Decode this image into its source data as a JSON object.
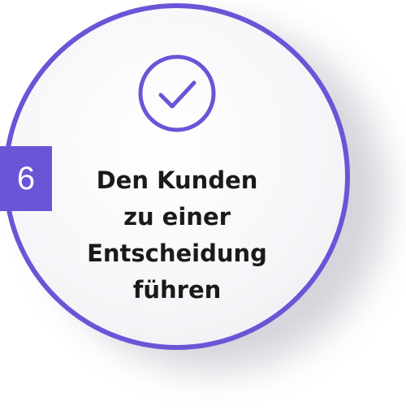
{
  "step": {
    "number": "6",
    "title_lines": [
      "Den Kunden",
      "zu einer",
      "Entscheidung",
      "führen"
    ]
  },
  "icons": {
    "status": "check-circle-icon"
  },
  "colors": {
    "accent": "#6a55d6",
    "text": "#1a1a1a",
    "badge_text": "#ffffff"
  }
}
